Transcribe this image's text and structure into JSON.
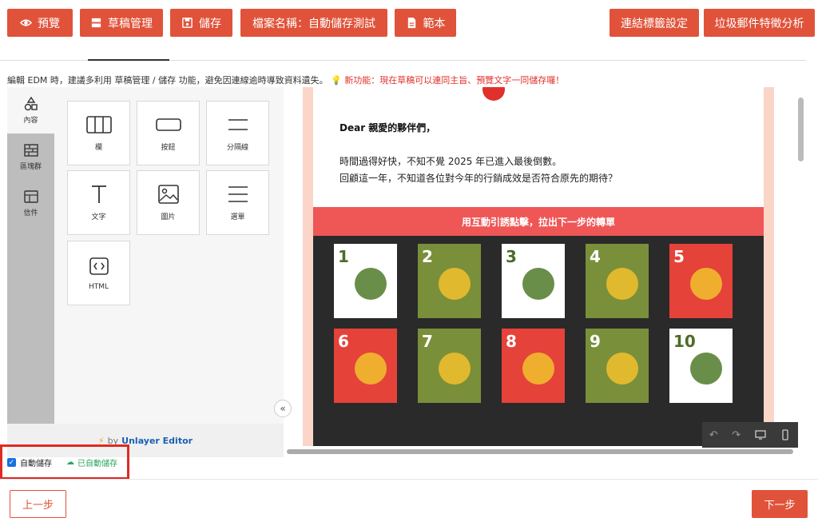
{
  "toolbar": {
    "preview_label": "預覽",
    "drafts_label": "草稿管理",
    "save_label": "儲存",
    "filename_label": "檔案名稱：自動儲存測試",
    "template_label": "範本",
    "link_tags_label": "連結標籤設定",
    "spam_analysis_label": "垃圾郵件特徵分析"
  },
  "notice": {
    "text": "編輯 EDM 時，建議多利用 草稿管理 / 儲存 功能，避免因連線逾時導致資料遺失。",
    "new_feature": "新功能：現在草稿可以連同主旨、預覽文字一同儲存囉！"
  },
  "sidebar": {
    "items": [
      {
        "label": "內容",
        "icon": "shapes-icon"
      },
      {
        "label": "區塊群",
        "icon": "blocks-icon"
      },
      {
        "label": "信件",
        "icon": "layout-icon"
      }
    ]
  },
  "tools": [
    {
      "label": "欄",
      "icon": "columns-icon"
    },
    {
      "label": "按鈕",
      "icon": "button-icon"
    },
    {
      "label": "分隔線",
      "icon": "divider-icon"
    },
    {
      "label": "文字",
      "icon": "text-icon"
    },
    {
      "label": "圖片",
      "icon": "image-icon"
    },
    {
      "label": "選單",
      "icon": "menu-icon"
    },
    {
      "label": "HTML",
      "icon": "code-icon"
    }
  ],
  "brand": {
    "by": "by",
    "name": "Unlayer Editor"
  },
  "email": {
    "greeting": "Dear 親愛的夥伴們，",
    "line1": "時間過得好快，不知不覺 2025 年已進入最後倒數。",
    "line2": "回顧這一年，不知道各位對今年的行銷成效是否符合原先的期待？",
    "banner": "用互動引誘點擊，拉出下一步的轉單",
    "cells": [
      {
        "num": "1",
        "bg": "#ffffff",
        "color": "#4f6b2a"
      },
      {
        "num": "2",
        "bg": "#7a8f3a",
        "color": "#ffffff"
      },
      {
        "num": "3",
        "bg": "#ffffff",
        "color": "#4f6b2a"
      },
      {
        "num": "4",
        "bg": "#7a8f3a",
        "color": "#ffffff"
      },
      {
        "num": "5",
        "bg": "#e5423a",
        "color": "#ffffff"
      },
      {
        "num": "6",
        "bg": "#e5423a",
        "color": "#ffffff"
      },
      {
        "num": "7",
        "bg": "#7a8f3a",
        "color": "#ffffff"
      },
      {
        "num": "8",
        "bg": "#e5423a",
        "color": "#ffffff"
      },
      {
        "num": "9",
        "bg": "#7a8f3a",
        "color": "#ffffff"
      },
      {
        "num": "10",
        "bg": "#ffffff",
        "color": "#4f6b2a"
      }
    ]
  },
  "autosave": {
    "label": "自動儲存",
    "status": "已自動儲存"
  },
  "footer": {
    "prev_label": "上一步",
    "next_label": "下一步"
  },
  "colors": {
    "accent": "#e0533a",
    "highlight_box": "#e02a22",
    "saved_green": "#2aa45f"
  }
}
